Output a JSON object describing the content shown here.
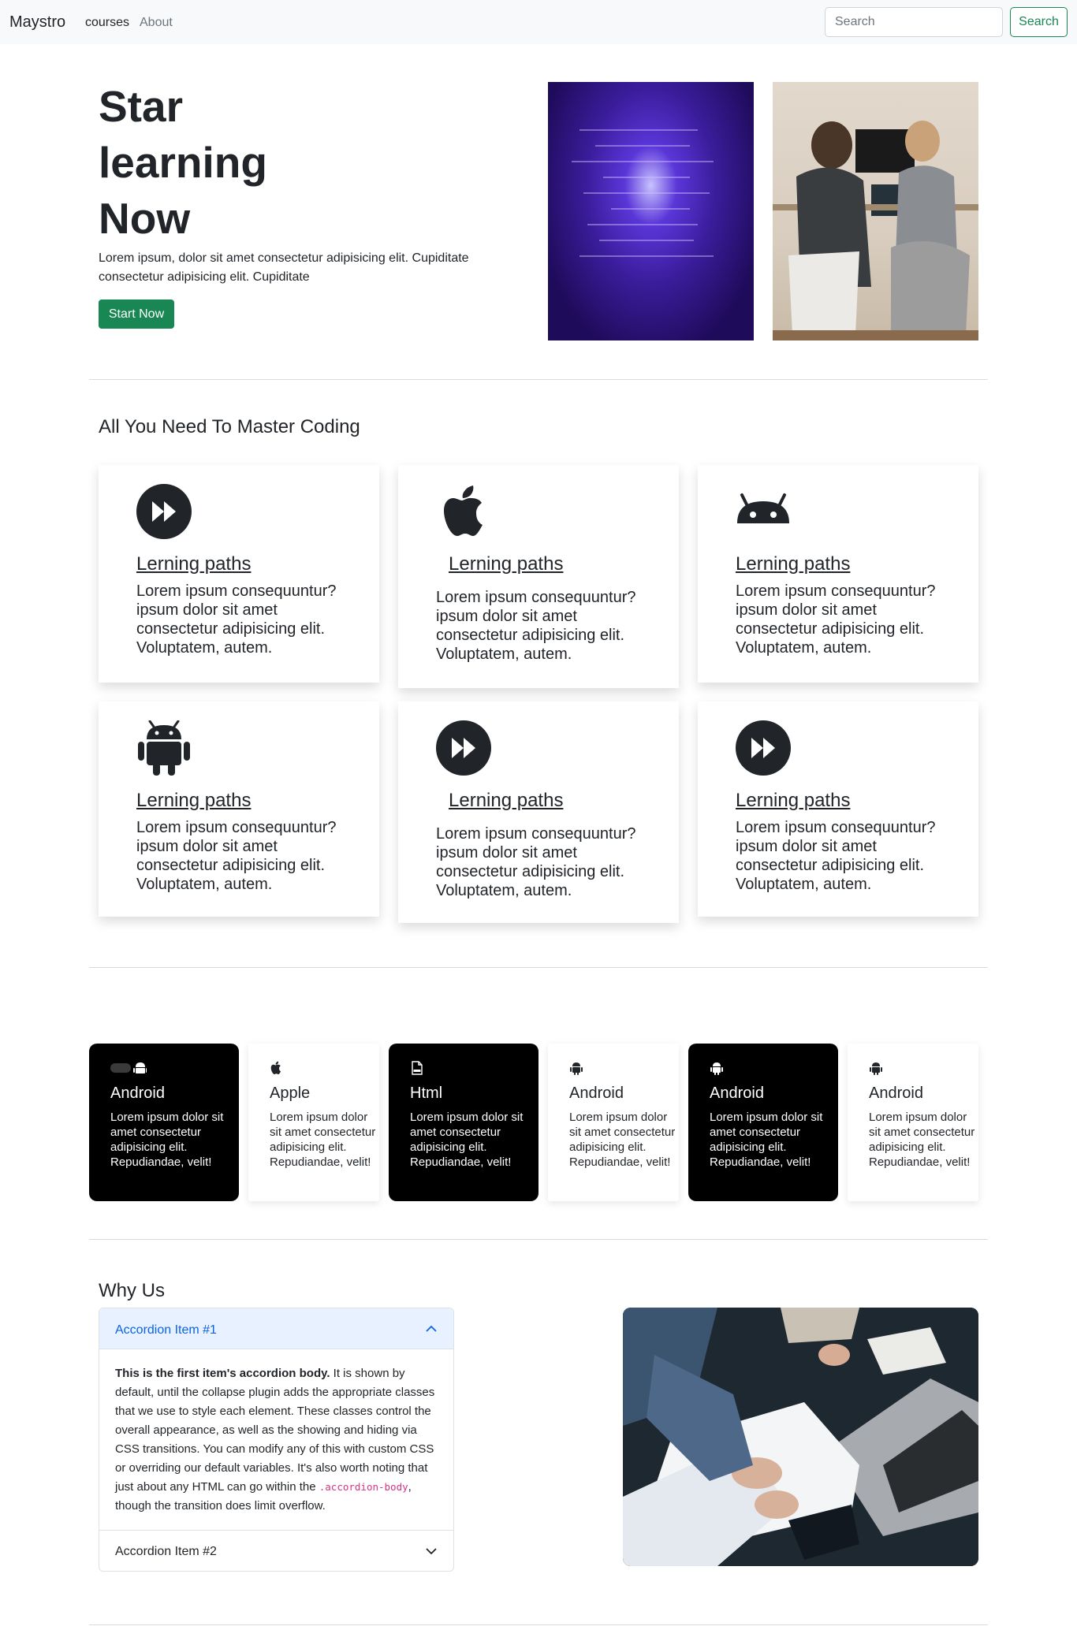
{
  "nav": {
    "brand": "Maystro",
    "links": [
      "courses",
      "About"
    ],
    "search_placeholder": "Search",
    "search_button": "Search"
  },
  "hero": {
    "title": "Star learning Now",
    "text": "Lorem ipsum, dolor sit amet consectetur adipisicing elit. Cupiditate consectetur adipisicing elit. Cupiditate",
    "button": "Start Now"
  },
  "features": {
    "heading": "All You Need To Master Coding",
    "cards": [
      {
        "icon": "fast-forward-circle-icon",
        "title": "Lerning paths",
        "text": "Lorem ipsum consequuntur? ipsum dolor sit amet consectetur adipisicing elit. Voluptatem, autem."
      },
      {
        "icon": "apple-icon",
        "title": "Lerning paths",
        "text": "Lorem ipsum consequuntur? ipsum dolor sit amet consectetur adipisicing elit. Voluptatem, autem."
      },
      {
        "icon": "android-head-icon",
        "title": "Lerning paths",
        "text": "Lorem ipsum consequuntur? ipsum dolor sit amet consectetur adipisicing elit. Voluptatem, autem."
      },
      {
        "icon": "android-icon",
        "title": "Lerning paths",
        "text": "Lorem ipsum consequuntur? ipsum dolor sit amet consectetur adipisicing elit. Voluptatem, autem."
      },
      {
        "icon": "fast-forward-circle-icon",
        "title": "Lerning paths",
        "text": "Lorem ipsum consequuntur? ipsum dolor sit amet consectetur adipisicing elit. Voluptatem, autem."
      },
      {
        "icon": "fast-forward-circle-icon",
        "title": "Lerning paths",
        "text": "Lorem ipsum consequuntur? ipsum dolor sit amet consectetur adipisicing elit. Voluptatem, autem."
      }
    ]
  },
  "platforms": [
    {
      "icon": "toggle-android-icon",
      "title": "Android",
      "text": "Lorem ipsum dolor sit amet consectetur adipisicing elit. Repudiandae, velit!",
      "style": "dark"
    },
    {
      "icon": "apple-icon",
      "title": "Apple",
      "text": "Lorem ipsum dolor sit amet consectetur adipisicing elit. Repudiandae, velit!",
      "style": "light"
    },
    {
      "icon": "html-file-icon",
      "title": "Html",
      "text": "Lorem ipsum dolor sit amet consectetur adipisicing elit. Repudiandae, velit!",
      "style": "dark"
    },
    {
      "icon": "android-icon",
      "title": "Android",
      "text": "Lorem ipsum dolor sit amet consectetur adipisicing elit. Repudiandae, velit!",
      "style": "light"
    },
    {
      "icon": "android-icon",
      "title": "Android",
      "text": "Lorem ipsum dolor sit amet consectetur adipisicing elit. Repudiandae, velit!",
      "style": "dark"
    },
    {
      "icon": "android-icon",
      "title": "Android",
      "text": "Lorem ipsum dolor sit amet consectetur adipisicing elit. Repudiandae, velit!",
      "style": "light"
    }
  ],
  "why": {
    "heading": "Why Us",
    "accordion": {
      "item1_title": "Accordion Item #1",
      "item1_body_bold": "This is the first item's accordion body.",
      "item1_body_text": " It is shown by default, until the collapse plugin adds the appropriate classes that we use to style each element. These classes control the overall appearance, as well as the showing and hiding via CSS transitions. You can modify any of this with custom CSS or overriding our default variables. It's also worth noting that just about any HTML can go within the ",
      "item1_body_code": ".accordion-body",
      "item1_body_end": ", though the transition does limit overflow.",
      "item2_title": "Accordion Item #2"
    }
  },
  "colors": {
    "primary_green": "#198754",
    "accordion_active_bg": "#e7f1ff",
    "accordion_active_text": "#0c63e4",
    "dark_card": "#000000"
  }
}
